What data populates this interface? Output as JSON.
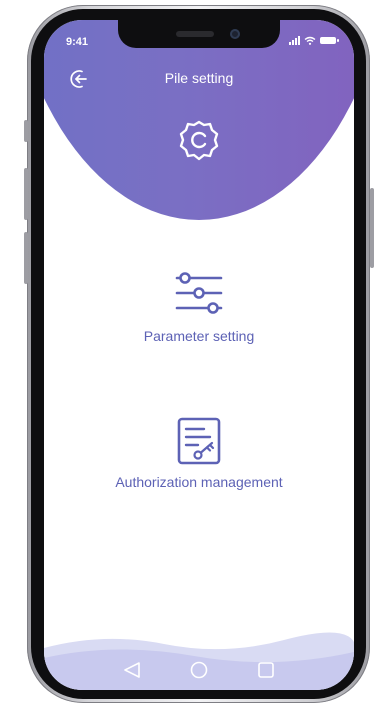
{
  "status_bar": {
    "time": "9:41"
  },
  "header": {
    "title": "Pile setting",
    "back_icon": "back-arrow-icon",
    "icon": "gear-icon"
  },
  "menu": [
    {
      "label": "Parameter setting",
      "icon": "sliders-icon"
    },
    {
      "label": "Authorization management",
      "icon": "document-key-icon"
    }
  ],
  "nav_bar": {
    "icons": [
      "back-triangle-icon",
      "home-circle-icon",
      "recent-square-icon"
    ]
  },
  "colors": {
    "accent": "#5d62b5",
    "header_start": "#6f71c6",
    "header_end": "#8361be"
  }
}
